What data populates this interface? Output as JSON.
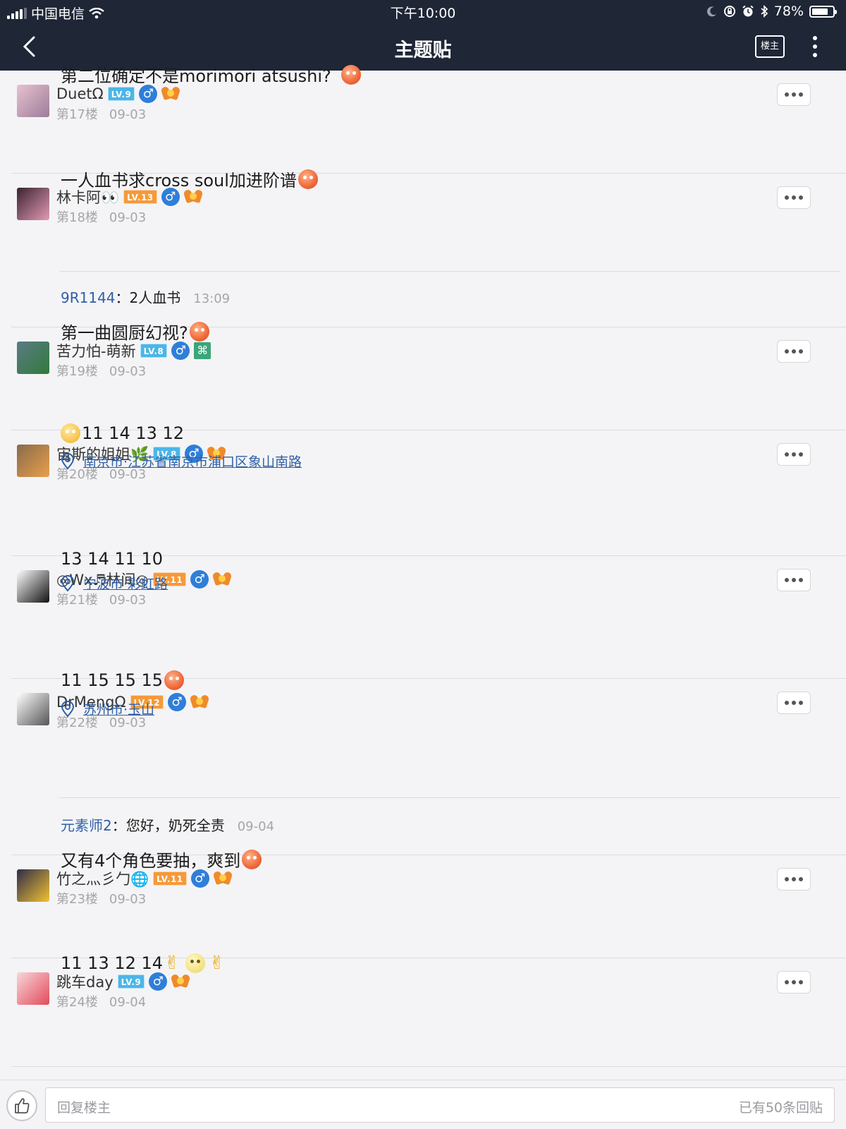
{
  "status_bar": {
    "carrier": "中国电信",
    "time": "下午10:00",
    "battery": "78%",
    "battery_level": 0.78
  },
  "nav": {
    "title": "主题贴",
    "louzhu_label": "楼主"
  },
  "colors": {
    "header_bg": "#1f2636",
    "level_blue": "#4bb6e8",
    "level_orange": "#f59a3a",
    "link_blue": "#2f5fa5",
    "gender_blue": "#2f7ed8"
  },
  "posts": [
    {
      "username": "DuetΩ",
      "level": "LV.9",
      "level_color": "#4bb6e8",
      "gender": "♂",
      "badge": "medal-icon",
      "floor": "第17楼",
      "date": "09-03",
      "content": "第二位确定不是morimori atsushi?",
      "content_emoji": "grin",
      "avatar_colors": [
        "#e7c2cf",
        "#9d7c9a"
      ]
    },
    {
      "username": "林卡阿👀",
      "level": "LV.13",
      "level_color": "#f59a3a",
      "gender": "♂",
      "badge": "medal-icon",
      "floor": "第18楼",
      "date": "09-03",
      "content": "一人血书求cross soul加进阶谱",
      "content_emoji": "grin",
      "avatar_colors": [
        "#3a2330",
        "#e39ab4"
      ],
      "reply": {
        "user": "9R1144",
        "text": "：2人血书",
        "time": "13:09"
      }
    },
    {
      "username": "苦力怕-萌新",
      "level": "LV.8",
      "level_color": "#4bb6e8",
      "gender": "♂",
      "badge": "square-badge",
      "badge_text": "⌘",
      "floor": "第19楼",
      "date": "09-03",
      "content": "第一曲圆厨幻视?",
      "content_emoji": "grin",
      "avatar_colors": [
        "#5c7a86",
        "#2f7b3a"
      ]
    },
    {
      "username": "宙斯的姐姐🌿",
      "level": "LV.8",
      "level_color": "#4bb6e8",
      "gender": "♂",
      "badge": "medal-icon",
      "floor": "第20楼",
      "date": "09-03",
      "content": "11 14 13 12",
      "content_emoji_lead": "smile",
      "location": "南京市·江苏省南京市浦口区象山南路",
      "avatar_colors": [
        "#8a6a4c",
        "#e8a04a"
      ]
    },
    {
      "username": "◎Wx♬林间◎",
      "level": "LV.11",
      "level_color": "#f59a3a",
      "gender": "♂",
      "badge": "medal-icon",
      "floor": "第21楼",
      "date": "09-03",
      "content": "13 14 11 10",
      "location": "宁波市·彩虹路",
      "avatar_colors": [
        "#ffffff",
        "#111111"
      ]
    },
    {
      "username": "DrMengΩ",
      "level": "LV.12",
      "level_color": "#f59a3a",
      "gender": "♂",
      "badge": "medal-icon",
      "floor": "第22楼",
      "date": "09-03",
      "content": "11 15 15 15",
      "content_emoji": "grin",
      "location": "苏州市·玉山",
      "avatar_colors": [
        "#ffffff",
        "#555555"
      ],
      "reply": {
        "user": "元素师2",
        "text": "：您好，奶死全责",
        "time": "09-04"
      }
    },
    {
      "username": "竹之灬彡勹🌐",
      "level": "LV.11",
      "level_color": "#f59a3a",
      "gender": "♂",
      "badge": "medal-icon",
      "floor": "第23楼",
      "date": "09-03",
      "content": "又有4个角色要抽，爽到",
      "content_emoji": "grin",
      "avatar_colors": [
        "#2d2b4a",
        "#f1c232"
      ]
    },
    {
      "username": "跳车day",
      "level": "LV.9",
      "level_color": "#4bb6e8",
      "gender": "♂",
      "badge": "medal-icon",
      "floor": "第24楼",
      "date": "09-04",
      "content": "11 13 12 14",
      "content_tail": "victory-pale-victory",
      "avatar_colors": [
        "#f7d7da",
        "#e34a5a"
      ]
    }
  ],
  "bottom": {
    "placeholder": "回复楼主",
    "reply_count": "已有50条回贴"
  }
}
